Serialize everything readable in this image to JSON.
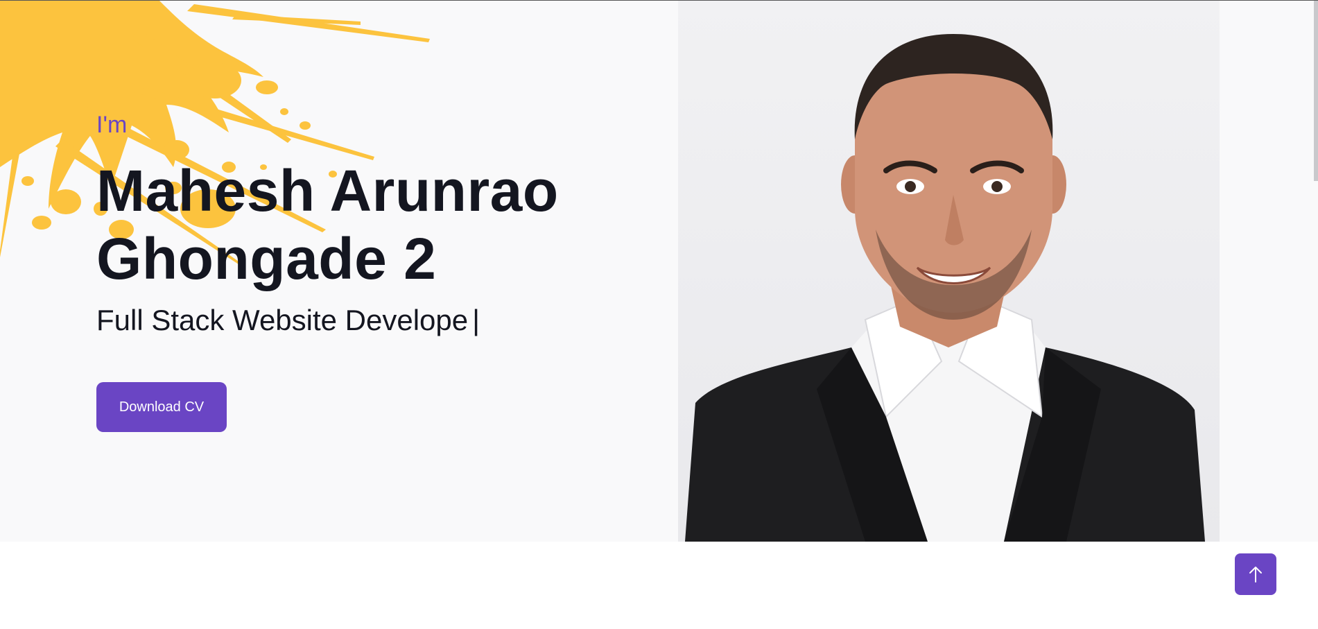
{
  "hero": {
    "intro": "I'm",
    "name_line1": "Mahesh Arunrao",
    "name_line2": "Ghongade 2",
    "role": "Full Stack Website Develope",
    "cursor": "|",
    "download_label": "Download CV"
  },
  "colors": {
    "accent": "#6a45c4",
    "splash": "#fcc33e",
    "text": "#141620",
    "hero_bg": "#f9f9fa"
  },
  "icons": {
    "scroll_top": "arrow-up-icon",
    "splash": "paint-splash-decoration"
  }
}
